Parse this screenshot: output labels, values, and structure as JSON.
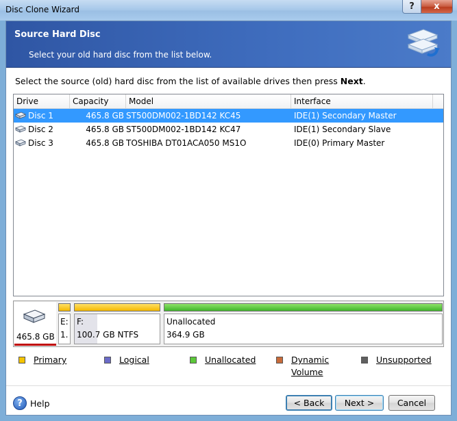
{
  "window": {
    "title": "Disc Clone Wizard",
    "help_glyph": "?",
    "close_glyph": "x"
  },
  "banner": {
    "title": "Source Hard Disc",
    "subtitle": "Select your old hard disc from the list below.",
    "icon": "disc-clone-icon"
  },
  "instruction": {
    "prefix": "Select the source (old) hard disc from the list of available drives then press ",
    "bold": "Next",
    "suffix": "."
  },
  "list": {
    "columns": [
      "Drive",
      "Capacity",
      "Model",
      "Interface"
    ],
    "rows": [
      {
        "drive": "Disc 1",
        "capacity": "465.8 GB",
        "model": "ST500DM002-1BD142 KC45",
        "interface": "IDE(1) Secondary Master",
        "selected": true
      },
      {
        "drive": "Disc 2",
        "capacity": "465.8 GB",
        "model": "ST500DM002-1BD142 KC47",
        "interface": "IDE(1) Secondary Slave",
        "selected": false
      },
      {
        "drive": "Disc 3",
        "capacity": "465.8 GB",
        "model": "TOSHIBA DT01ACA050 MS1O",
        "interface": "IDE(0) Primary Master",
        "selected": false
      }
    ]
  },
  "partition_map": {
    "disk_size": "465.8 GB",
    "partitions": [
      {
        "line1": "E:",
        "line2": "1.",
        "type": "Primary"
      },
      {
        "line1": "F:",
        "line2": "100.7 GB  NTFS",
        "type": "Primary",
        "used_fraction": 0.27
      },
      {
        "line1": "Unallocated",
        "line2": "364.9 GB",
        "type": "Unallocated"
      }
    ]
  },
  "legend": [
    {
      "label": "Primary",
      "color": "#f5c400"
    },
    {
      "label": "Logical",
      "color": "#6b6bc8"
    },
    {
      "label": "Unallocated",
      "color": "#5cc83a"
    },
    {
      "label": "Dynamic Volume",
      "color": "#c86b3a"
    },
    {
      "label": "Unsupported",
      "color": "#606060"
    }
  ],
  "footer": {
    "help_label": "Help",
    "back_label": "< Back",
    "next_label": "Next >",
    "cancel_label": "Cancel"
  },
  "colors": {
    "selection": "#3399ff",
    "banner": "#3f6dbe",
    "primary_bar": "#f5b800",
    "unallocated_bar": "#3fb52a"
  }
}
